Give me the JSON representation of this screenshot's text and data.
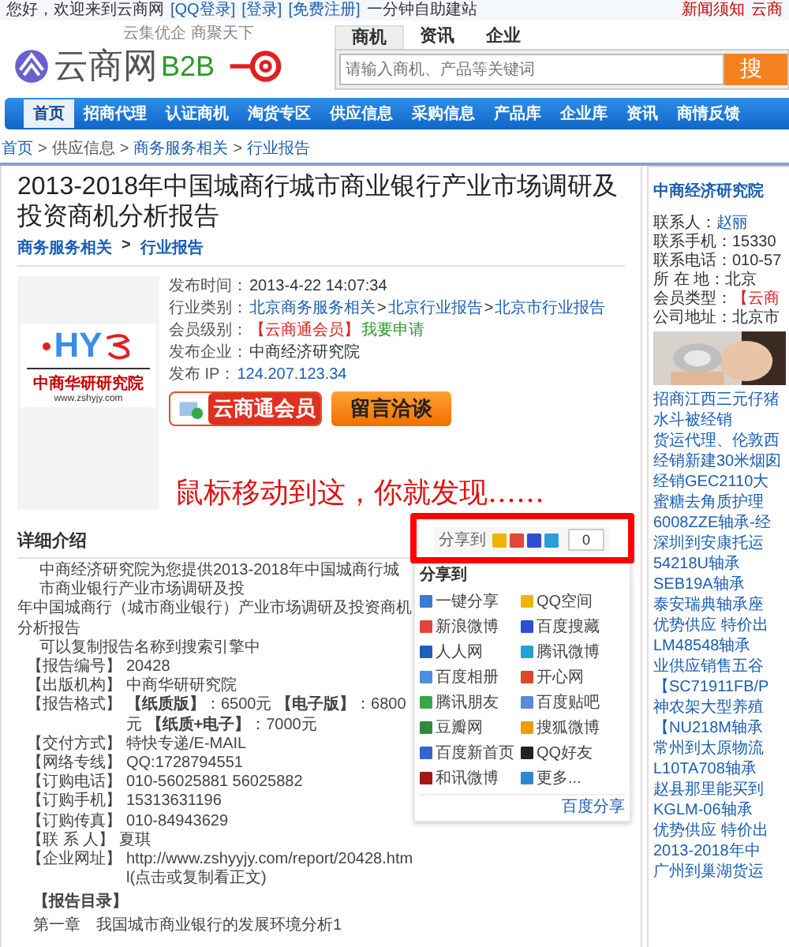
{
  "top_bar": {
    "greeting": "您好，欢迎来到云商网",
    "links": [
      "[QQ登录]",
      "[登录]",
      "[免费注册]"
    ],
    "promo": "一分钟自助建站",
    "right_links": [
      "新闻须知",
      "云商"
    ]
  },
  "header": {
    "slogan": "云集优企 商聚天下",
    "brand": "云商网",
    "brand_suffix": "B2B"
  },
  "search": {
    "tabs": [
      {
        "label": "商机",
        "selected": true
      },
      {
        "label": "资讯",
        "selected": false
      },
      {
        "label": "企业",
        "selected": false
      }
    ],
    "placeholder": "请输入商机、产品等关键词",
    "button": "搜"
  },
  "nav": [
    {
      "label": "首页",
      "selected": true
    },
    {
      "label": "招商代理",
      "selected": false
    },
    {
      "label": "认证商机",
      "selected": false
    },
    {
      "label": "淘货专区",
      "selected": false
    },
    {
      "label": "供应信息",
      "selected": false
    },
    {
      "label": "采购信息",
      "selected": false
    },
    {
      "label": "产品库",
      "selected": false
    },
    {
      "label": "企业库",
      "selected": false
    },
    {
      "label": "资讯",
      "selected": false
    },
    {
      "label": "商情反馈",
      "selected": false
    }
  ],
  "breadcrumb_separator": ">",
  "breadcrumb": [
    {
      "label": "首页",
      "link": true
    },
    {
      "label": "供应信息",
      "link": false
    },
    {
      "label": "商务服务相关",
      "link": true
    },
    {
      "label": "行业报告",
      "link": true
    }
  ],
  "title": "2013-2018年中国城商行城市商业银行产业市场调研及投资商机分析报告",
  "category_separator": ">",
  "category_path": [
    "商务服务相关",
    "行业报告"
  ],
  "company_logo": {
    "mark": "HY",
    "name": "中商华研研究院",
    "url": "www.zshyjy.com"
  },
  "info": [
    {
      "label": "发布时间：",
      "kind": "plain",
      "values": [
        "2013-4-22 14:07:34"
      ]
    },
    {
      "label": "行业类别：",
      "kind": "links",
      "separator": ">",
      "values": [
        "北京商务服务相关",
        "北京行业报告",
        "北京市行业报告"
      ]
    },
    {
      "label": "会员级别：",
      "kind": "member",
      "values": [
        "【云商通会员】",
        "我要申请"
      ]
    },
    {
      "label": "发布企业：",
      "kind": "plain",
      "values": [
        "中商经济研究院"
      ]
    },
    {
      "label": "发布 IP：",
      "kind": "ip",
      "values": [
        "124.207.123.34"
      ]
    }
  ],
  "buttons": {
    "member": "云商通会员",
    "message": "留言洽谈"
  },
  "annotation": "鼠标移动到这，你就发现……",
  "details": {
    "heading": "详细介绍",
    "share_label": "分享到",
    "share_count": "0",
    "lines": [
      "中商经济研究院为您提供2013-2018年中国城商行城市商业银行产业市场调研及投",
      "年中国城商行（城市商业银行）产业市场调研及投资商机分析报告",
      "可以复制报告名称到搜索引擎中"
    ],
    "fields": [
      {
        "label": "【报告编号】",
        "value": "20428"
      },
      {
        "label": "【出版机构】",
        "value": "中商华研研究院"
      },
      {
        "label": "【报告格式】",
        "value": "**【纸质版】**：6500元 **【电子版】**：6800元 **【纸质+电子】**：7000元"
      },
      {
        "label": "【交付方式】",
        "value": "特快专递/E-MAIL"
      },
      {
        "label": "【网络专线】",
        "value": "QQ:1728794551"
      },
      {
        "label": "【订购电话】",
        "value": "010-56025881 56025882"
      },
      {
        "label": "【订购手机】",
        "value": "15313631196"
      },
      {
        "label": "【订购传真】",
        "value": "010-84943629"
      },
      {
        "label": "【联 系 人】",
        "value": "夏琪"
      },
      {
        "label": "【企业网址】",
        "value": "http://www.zshyyjy.com/report/20428.html(点击或复制看正文)"
      }
    ],
    "toc_heading": "【报告目录】",
    "toc_first": "第一章　我国城市商业银行的发展环境分析1"
  },
  "share_menu": {
    "title": "分享到",
    "items": [
      {
        "label": "一键分享",
        "color": "#3a7bd5"
      },
      {
        "label": "QQ空间",
        "color": "#f0b400"
      },
      {
        "label": "新浪微博",
        "color": "#e0463a"
      },
      {
        "label": "百度搜藏",
        "color": "#2b4fd0"
      },
      {
        "label": "人人网",
        "color": "#1f5fb8"
      },
      {
        "label": "腾讯微博",
        "color": "#2a9fd6"
      },
      {
        "label": "百度相册",
        "color": "#4a8fe0"
      },
      {
        "label": "开心网",
        "color": "#d94a2a"
      },
      {
        "label": "腾讯朋友",
        "color": "#3aa64a"
      },
      {
        "label": "百度贴吧",
        "color": "#5a8ad8"
      },
      {
        "label": "豆瓣网",
        "color": "#2e8b3a"
      },
      {
        "label": "搜狐微博",
        "color": "#e8a000"
      },
      {
        "label": "百度新首页",
        "color": "#3366cc"
      },
      {
        "label": "QQ好友",
        "color": "#222222"
      },
      {
        "label": "和讯微博",
        "color": "#a01818"
      },
      {
        "label": "更多...",
        "color": "#2f86d6"
      }
    ],
    "footer": "百度分享"
  },
  "sidebar": {
    "company": "中商经济研究院",
    "contacts": [
      {
        "label": "联系人：",
        "value": "赵丽"
      },
      {
        "label": "联系手机：",
        "value": "15330"
      },
      {
        "label": "联系电话：",
        "value": "010-57"
      },
      {
        "label": "所 在 地：",
        "value": "北京"
      },
      {
        "label": "会员类型：",
        "value": "【云商"
      },
      {
        "label": "公司地址：",
        "value": "北京市"
      }
    ],
    "products": [
      "招商江西三元仔猪",
      "水斗被经销",
      "货运代理、伦敦西",
      "经销新建30米烟囱",
      "经销GEC2110大",
      "蜜糖去角质护理",
      "6008ZZE轴承-经",
      "深圳到安康托运",
      "54218U轴承",
      "SEB19A轴承",
      "泰安瑞典轴承座",
      "优势供应 特价出",
      "LM48548轴承",
      "业供应销售五谷",
      "【SC71911FB/P",
      "神农架大型养殖",
      "【NU218M轴承",
      "常州到太原物流",
      "L10TA708轴承",
      "赵县那里能买到",
      "KGLM-06轴承",
      "优势供应 特价出",
      "2013-2018年中",
      "广州到巢湖货运"
    ]
  }
}
